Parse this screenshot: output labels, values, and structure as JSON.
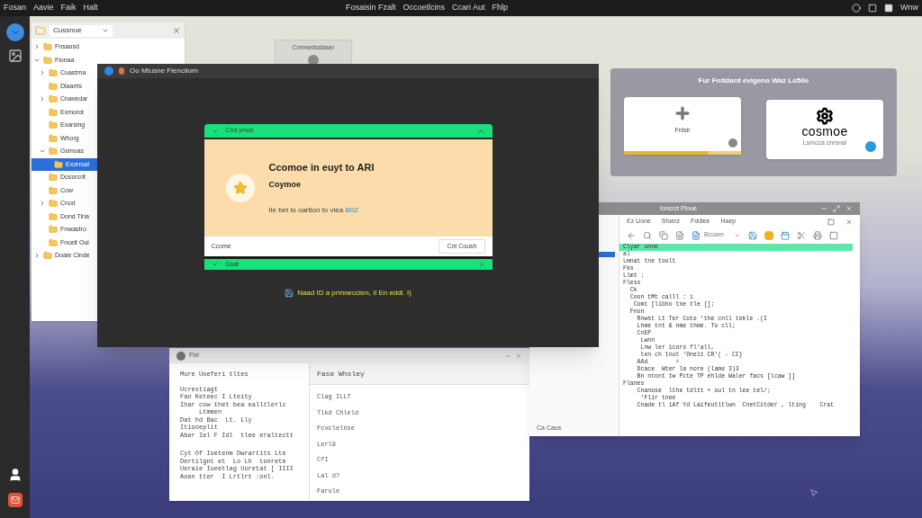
{
  "top_bar": {
    "menus": [
      "Fosan",
      "Aavie",
      "Faik",
      "Halt"
    ],
    "center_menus": [
      "Fosaisin Fzalt",
      "Occoetlcins",
      "Ccari Aut",
      "Fhlp"
    ],
    "right_text": "Wnw"
  },
  "file_window": {
    "location": "Cussnoe",
    "tree": [
      {
        "label": "Fnsausd",
        "expanded": false,
        "selected": false
      },
      {
        "label": "Fionaa",
        "expanded": true,
        "selected": false,
        "children": [
          {
            "label": "Cuastrna",
            "expanded": false,
            "selected": false
          },
          {
            "label": "Dlaarris",
            "selected": false
          },
          {
            "label": "Cnavedar",
            "expanded": false,
            "selected": false
          },
          {
            "label": "Exmorot",
            "selected": false
          },
          {
            "label": "Exarsing",
            "selected": false
          },
          {
            "label": "Whorg",
            "selected": false
          },
          {
            "label": "Gsmoas",
            "expanded": true,
            "selected": false,
            "children": [
              {
                "label": "Exorroal",
                "selected": true
              }
            ]
          },
          {
            "label": "Dosorcrit",
            "selected": false
          },
          {
            "label": "Cow",
            "selected": false
          },
          {
            "label": "Cnod",
            "expanded": false,
            "selected": false
          },
          {
            "label": "Dond Tiria",
            "selected": false
          },
          {
            "label": "Fnwastro",
            "selected": false
          },
          {
            "label": "Fncelt Oui",
            "selected": false
          }
        ]
      },
      {
        "label": "Doaie Cinde",
        "expanded": false,
        "selected": false
      }
    ]
  },
  "back_window": {
    "title": "Cmmedsstaser"
  },
  "main_window": {
    "title": "Oo Mtusne Fiencilorn",
    "dialog": {
      "header": "Cnd ynwe",
      "title": "Ccomoe in euyt to ARI",
      "subtitle": "Coymoe",
      "text": "Ile bet lo oartlon to vlea",
      "link": "BIIZ",
      "footer_label": "Ccome",
      "button": "Cnt Coush",
      "bottom_bar": "Gsal"
    },
    "status": "Naad ID a prmnecclen, Il En eddl. I)"
  },
  "card_panel": {
    "title": "Fur Fnitdard evigeno Waz Lo5ile",
    "cards": [
      {
        "kind": "add",
        "label": "Fnlsir",
        "level": 0.72
      },
      {
        "kind": "logo",
        "label": "cosmoe",
        "caption": "Lsmcca cnrsnal"
      }
    ]
  },
  "editor_window": {
    "title": "Ioncrct Ploue",
    "menus": [
      "Ez Uone",
      "Sfoerz",
      "Fddlee",
      "Haep"
    ],
    "dropdown": "Bcoam",
    "lines": [
      "Clyar unne",
      "al",
      "Lmnat tne toolt",
      "Fks",
      "Llmt :",
      "Fless",
      "  Ck",
      "  Coon tMt calll : i",
      "   Comt [libho tne tle [];",
      "  Fnon",
      "    Rnwst Lt Ter Cote 'the cnll tekle .(I",
      "    Lhme tnt & nme thme. To cll;",
      "    CnEP",
      "     Lwnn",
      "     Lnw ler icoro fl'all,",
      "     ten ch tnut 'Oneit CR'( - CI}",
      "    AAd        =",
      "    Dcace  Wter la nore (lame 3)3",
      "    Bn ntont tw Pcte TP ehlde Waler facs [lcaw ]]",
      "Flanes",
      "    Cnanose  lthe tdltt + oul tn lee tel/;",
      "     'Flir tnee",
      "    Cnade tl iAf Yd Laifeutltlwn  CnetCitder , lting    Crat"
    ],
    "footer": "Ca Caus"
  },
  "notes_window": {
    "title": "Fixl",
    "left_heading": "Mure Uoeferi tltes",
    "paragraphs": [
      [
        "Ucrestiagt",
        "Fan Keteec I Lteity",
        "Ihar cow thet bea ealltlerlc",
        "     Ltmmen",
        "Dat hd Bac  Lt. Lly",
        "Itiooeplit",
        "Aber Iel F Idl  tlee eraltectt"
      ],
      [
        "Cyt Of Ioetenm Dwrartits Lte",
        "Dertilgnt et  Lo Lh  tonrete",
        "Ueraie Iueetlag Uoretat [ IIII",
        "Aoen tter  I Lrtlrt :onl."
      ]
    ],
    "right_heading": "Fase Whsley",
    "right_items": [
      "Clag ILLT",
      "Tlkd Chleld",
      "Fcvclelnse",
      "Lerl9",
      "CfI",
      "Lal d?",
      "Farule"
    ]
  }
}
